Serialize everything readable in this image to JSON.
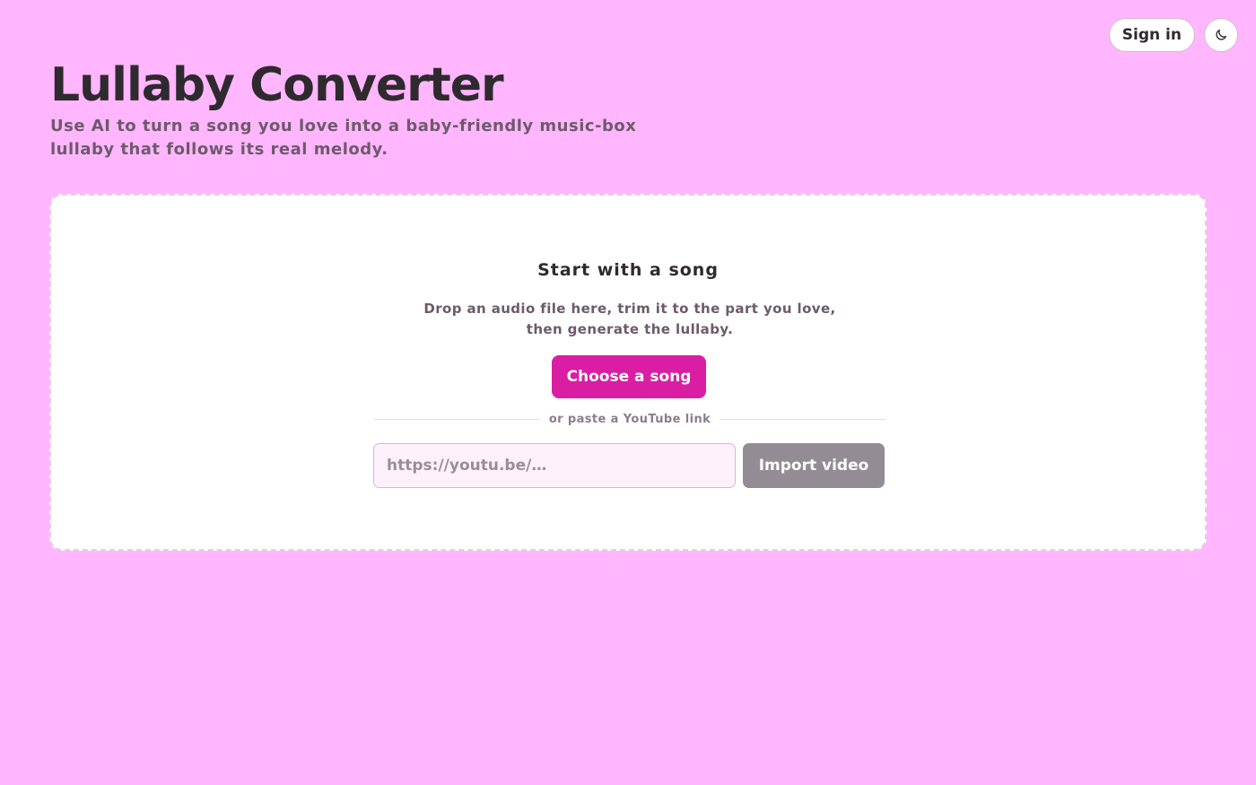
{
  "header": {
    "sign_in_label": "Sign in",
    "theme_toggle_icon": "moon-icon"
  },
  "hero": {
    "title": "Lullaby Converter",
    "subtitle": "Use AI to turn a song you love into a baby-friendly music-box lullaby that follows its real melody."
  },
  "card": {
    "title": "Start with a song",
    "description": "Drop an audio file here, trim it to the part you love, then generate the lullaby.",
    "choose_label": "Choose a song",
    "divider_text": "or paste a YouTube link",
    "youtube_input": {
      "value": "",
      "placeholder": "https://youtu.be/…"
    },
    "import_label": "Import video"
  },
  "colors": {
    "background": "#ffb6fd",
    "accent": "#da1ea4",
    "disabled_button": "#948c94",
    "text_dark": "#2e2a2e",
    "text_muted": "#6d5a6b"
  }
}
